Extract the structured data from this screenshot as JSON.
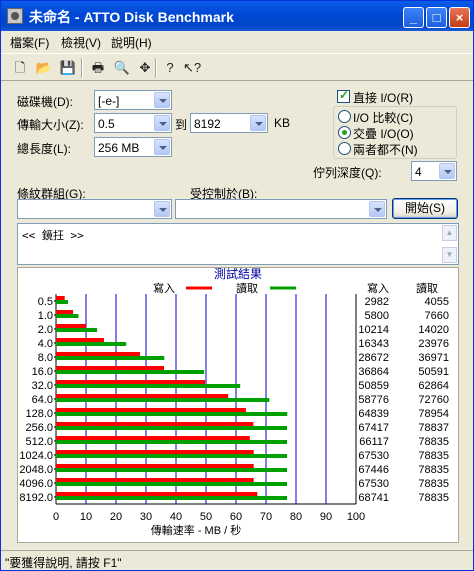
{
  "window": {
    "title": "未命名 - ATTO Disk Benchmark",
    "buttons": {
      "minimize": "_",
      "maximize": "□",
      "close": "×"
    }
  },
  "menu": [
    "檔案(F)",
    "檢視(V)",
    "說明(H)"
  ],
  "toolbar": [
    "new-icon",
    "open-icon",
    "save-icon",
    "print-icon",
    "print-preview-icon",
    "move-icon",
    "help-icon",
    "context-help-icon"
  ],
  "settings": {
    "drive_label": "磁碟機(D):",
    "drive_value": "[-e-]",
    "transfer_label": "傳輸大小(Z):",
    "transfer_from": "0.5",
    "to_label": "到",
    "transfer_to": "8192",
    "kb_label": "KB",
    "total_label": "總長度(L):",
    "total_value": "256 MB",
    "direct_io_label": "直接 I/O(R)",
    "direct_io_checked": true,
    "radio": [
      {
        "label": "I/O 比較(C)",
        "selected": false
      },
      {
        "label": "交疊 I/O(O)",
        "selected": true
      },
      {
        "label": "兩者都不(N)",
        "selected": false
      }
    ],
    "queue_label": "佇列深度(Q):",
    "queue_value": "4",
    "pattern_label": "條紋群組(G):",
    "pattern_value": "",
    "controlled_label": "受控制於(B):",
    "controlled_value": "",
    "start_button": "開始(S)",
    "log_text": "<< 鏡抂 >>"
  },
  "results": {
    "title": "測試結果",
    "col_write": "寫入",
    "col_read": "讀取",
    "write_color": "#ff0000",
    "read_color": "#00a000",
    "axis_color": "#0000cc"
  },
  "chart_data": {
    "type": "bar",
    "orientation": "horizontal",
    "title": "測試結果",
    "xlabel": "傳輸速率 - MB / 秒",
    "xlim": [
      0,
      100
    ],
    "xticks": [
      "0",
      "10",
      "20",
      "30",
      "40",
      "50",
      "60",
      "70",
      "80",
      "90",
      "100"
    ],
    "categories": [
      "0.5",
      "1.0",
      "2.0",
      "4.0",
      "8.0",
      "16.0",
      "32.0",
      "64.0",
      "128.0",
      "256.0",
      "512.0",
      "1024.0",
      "2048.0",
      "4096.0",
      "8192.0"
    ],
    "series": [
      {
        "name": "寫入",
        "values": [
          2.9,
          5.7,
          10.0,
          16.0,
          28.0,
          36.0,
          49.7,
          57.4,
          63.3,
          65.8,
          64.6,
          65.9,
          65.9,
          65.9,
          67.1
        ]
      },
      {
        "name": "讀取",
        "values": [
          4.0,
          7.5,
          13.7,
          23.4,
          36.1,
          49.4,
          61.4,
          71.1,
          77.1,
          77.0,
          77.0,
          77.0,
          77.0,
          77.0,
          77.0
        ]
      }
    ],
    "write_values": [
      "2982",
      "5800",
      "10214",
      "16343",
      "28672",
      "36864",
      "50859",
      "58776",
      "64839",
      "67417",
      "66117",
      "67530",
      "67446",
      "67530",
      "68741"
    ],
    "read_values": [
      "4055",
      "7660",
      "14020",
      "23976",
      "36971",
      "50591",
      "62864",
      "72760",
      "78954",
      "78837",
      "78835",
      "78835",
      "78835",
      "78835",
      "78835"
    ],
    "legend": "top"
  },
  "status_text": "\"要獲得說明, 請按 F1\""
}
